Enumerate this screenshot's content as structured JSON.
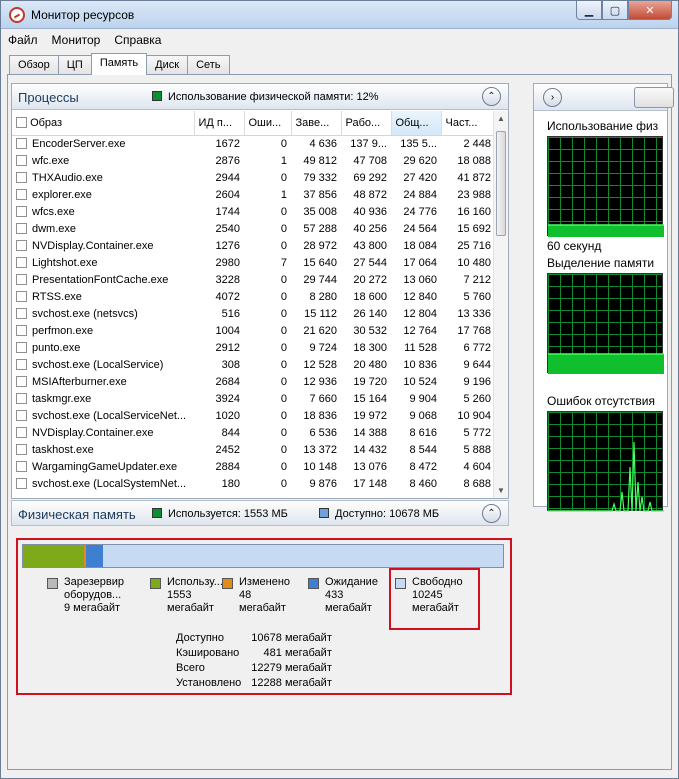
{
  "window": {
    "title": "Монитор ресурсов"
  },
  "menu": [
    "Файл",
    "Монитор",
    "Справка"
  ],
  "tabs": [
    {
      "label": "Обзор",
      "active": false
    },
    {
      "label": "ЦП",
      "active": false
    },
    {
      "label": "Память",
      "active": true
    },
    {
      "label": "Диск",
      "active": false
    },
    {
      "label": "Сеть",
      "active": false
    }
  ],
  "processes": {
    "title": "Процессы",
    "usage_label": "Использование физической памяти: 12%",
    "columns": [
      "Образ",
      "ИД п...",
      "Оши...",
      "Заве...",
      "Рабо...",
      "Общ...",
      "Част..."
    ],
    "rows": [
      [
        "EncoderServer.exe",
        "1672",
        "0",
        "4 636",
        "137 9...",
        "135 5...",
        "2 448"
      ],
      [
        "wfc.exe",
        "2876",
        "1",
        "49 812",
        "47 708",
        "29 620",
        "18 088"
      ],
      [
        "THXAudio.exe",
        "2944",
        "0",
        "79 332",
        "69 292",
        "27 420",
        "41 872"
      ],
      [
        "explorer.exe",
        "2604",
        "1",
        "37 856",
        "48 872",
        "24 884",
        "23 988"
      ],
      [
        "wfcs.exe",
        "1744",
        "0",
        "35 008",
        "40 936",
        "24 776",
        "16 160"
      ],
      [
        "dwm.exe",
        "2540",
        "0",
        "57 288",
        "40 256",
        "24 564",
        "15 692"
      ],
      [
        "NVDisplay.Container.exe",
        "1276",
        "0",
        "28 972",
        "43 800",
        "18 084",
        "25 716"
      ],
      [
        "Lightshot.exe",
        "2980",
        "7",
        "15 640",
        "27 544",
        "17 064",
        "10 480"
      ],
      [
        "PresentationFontCache.exe",
        "3228",
        "0",
        "29 744",
        "20 272",
        "13 060",
        "7 212"
      ],
      [
        "RTSS.exe",
        "4072",
        "0",
        "8 280",
        "18 600",
        "12 840",
        "5 760"
      ],
      [
        "svchost.exe (netsvcs)",
        "516",
        "0",
        "15 112",
        "26 140",
        "12 804",
        "13 336"
      ],
      [
        "perfmon.exe",
        "1004",
        "0",
        "21 620",
        "30 532",
        "12 764",
        "17 768"
      ],
      [
        "punto.exe",
        "2912",
        "0",
        "9 724",
        "18 300",
        "11 528",
        "6 772"
      ],
      [
        "svchost.exe (LocalService)",
        "308",
        "0",
        "12 528",
        "20 480",
        "10 836",
        "9 644"
      ],
      [
        "MSIAfterburner.exe",
        "2684",
        "0",
        "12 936",
        "19 720",
        "10 524",
        "9 196"
      ],
      [
        "taskmgr.exe",
        "3924",
        "0",
        "7 660",
        "15 164",
        "9 904",
        "5 260"
      ],
      [
        "svchost.exe (LocalServiceNet...",
        "1020",
        "0",
        "18 836",
        "19 972",
        "9 068",
        "10 904"
      ],
      [
        "NVDisplay.Container.exe",
        "844",
        "0",
        "6 536",
        "14 388",
        "8 616",
        "5 772"
      ],
      [
        "taskhost.exe",
        "2452",
        "0",
        "13 372",
        "14 432",
        "8 544",
        "5 888"
      ],
      [
        "WargamingGameUpdater.exe",
        "2884",
        "0",
        "10 148",
        "13 076",
        "8 472",
        "4 604"
      ],
      [
        "svchost.exe (LocalSystemNet...",
        "180",
        "0",
        "9 876",
        "17 148",
        "8 460",
        "8 688"
      ]
    ]
  },
  "memory": {
    "title": "Физическая память",
    "used_label": "Используется: 1553 МБ",
    "available_label": "Доступно: 10678 МБ",
    "bar_fractions": {
      "reserved": 0.0007,
      "in_use": 0.1265,
      "modified": 0.0039,
      "standby": 0.0353,
      "free": 0.8343
    },
    "colors": {
      "reserved": "#b9b9b9",
      "in_use": "#7ea918",
      "modified": "#e38a1c",
      "standby": "#3f7fd1",
      "free": "#c6daf3"
    },
    "legend": [
      {
        "key": "reserved",
        "line1": "Зарезервир",
        "line2": "оборудов...",
        "line3": "9 мегабайт"
      },
      {
        "key": "in_use",
        "line1": "Использу...",
        "line2": "1553",
        "line3": "мегабайт"
      },
      {
        "key": "modified",
        "line1": "Изменено",
        "line2": "48",
        "line3": "мегабайт"
      },
      {
        "key": "standby",
        "line1": "Ожидание",
        "line2": "433",
        "line3": "мегабайт"
      },
      {
        "key": "free",
        "line1": "Свободно",
        "line2": "10245",
        "line3": "мегабайт"
      }
    ],
    "stats": [
      {
        "label": "Доступно",
        "value": "10678 мегабайт"
      },
      {
        "label": "Кэшировано",
        "value": "481 мегабайт"
      },
      {
        "label": "Всего",
        "value": "12279 мегабайт"
      },
      {
        "label": "Установлено",
        "value": "12288 мегабайт"
      }
    ]
  },
  "right": {
    "graph1_label": "Использование физ",
    "graph1_caption": "60 секунд",
    "graph2_label": "Выделение памяти",
    "graph3_label": "Ошибок отсутствия"
  }
}
